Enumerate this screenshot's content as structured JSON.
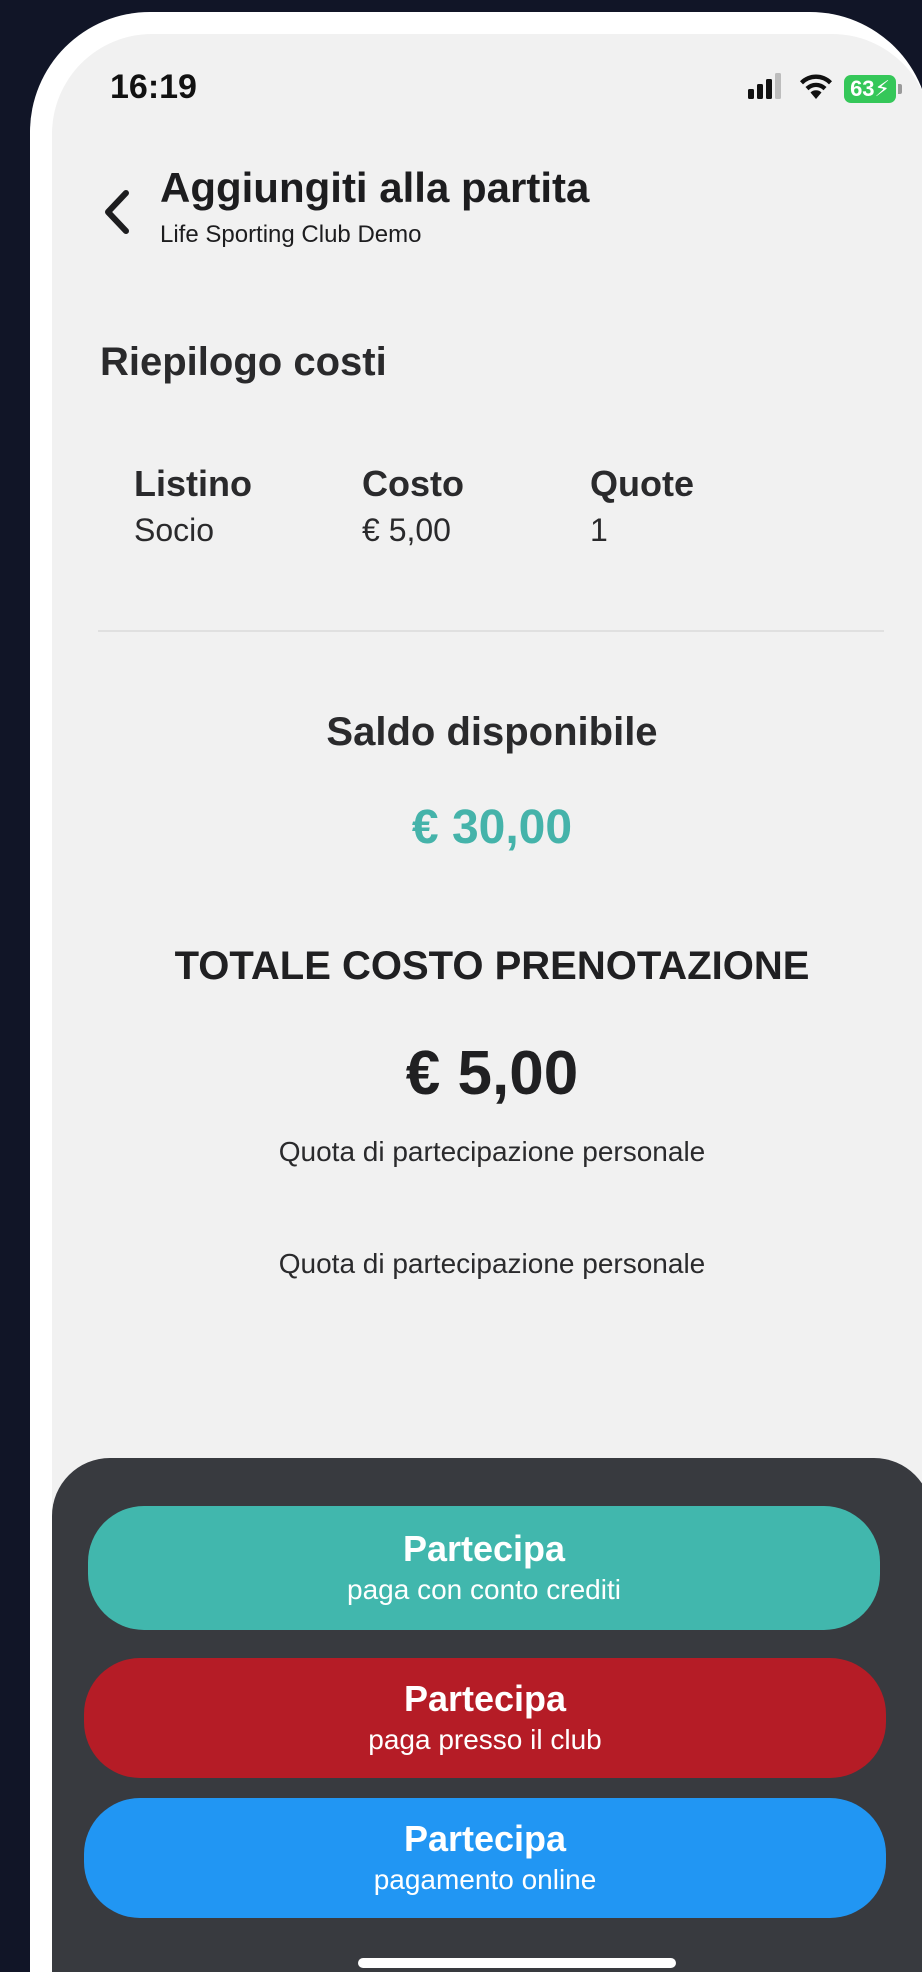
{
  "status_bar": {
    "time": "16:19",
    "battery": "63"
  },
  "header": {
    "title": "Aggiungiti alla partita",
    "subtitle": "Life Sporting Club Demo"
  },
  "summary": {
    "title": "Riepilogo costi",
    "columns": [
      {
        "header": "Listino",
        "value": "Socio"
      },
      {
        "header": "Costo",
        "value": "€ 5,00"
      },
      {
        "header": "Quote",
        "value": "1"
      }
    ]
  },
  "balance": {
    "label": "Saldo disponibile",
    "value": "€ 30,00",
    "color": "#45b3aa"
  },
  "total": {
    "label": "TOTALE COSTO PRENOTAZIONE",
    "value": "€ 5,00",
    "note_1": "Quota di partecipazione personale",
    "note_2": "Quota di partecipazione personale"
  },
  "actions": {
    "credits": {
      "title": "Partecipa",
      "subtitle": "paga con conto crediti",
      "color": "#41b7ad"
    },
    "club": {
      "title": "Partecipa",
      "subtitle": "paga presso il club",
      "color": "#b51c26"
    },
    "online": {
      "title": "Partecipa",
      "subtitle": "pagamento online",
      "color": "#2196f3"
    }
  },
  "icons": {
    "back": "chevron-left-icon",
    "signal": "cellular-signal-icon",
    "wifi": "wifi-icon",
    "battery": "battery-charging-icon"
  }
}
